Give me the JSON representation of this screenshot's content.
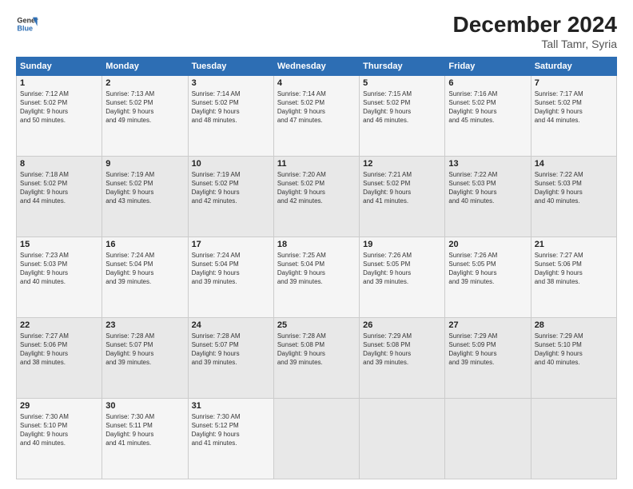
{
  "header": {
    "logo_line1": "General",
    "logo_line2": "Blue",
    "month": "December 2024",
    "location": "Tall Tamr, Syria"
  },
  "weekdays": [
    "Sunday",
    "Monday",
    "Tuesday",
    "Wednesday",
    "Thursday",
    "Friday",
    "Saturday"
  ],
  "weeks": [
    [
      {
        "day": "1",
        "info": "Sunrise: 7:12 AM\nSunset: 5:02 PM\nDaylight: 9 hours\nand 50 minutes."
      },
      {
        "day": "2",
        "info": "Sunrise: 7:13 AM\nSunset: 5:02 PM\nDaylight: 9 hours\nand 49 minutes."
      },
      {
        "day": "3",
        "info": "Sunrise: 7:14 AM\nSunset: 5:02 PM\nDaylight: 9 hours\nand 48 minutes."
      },
      {
        "day": "4",
        "info": "Sunrise: 7:14 AM\nSunset: 5:02 PM\nDaylight: 9 hours\nand 47 minutes."
      },
      {
        "day": "5",
        "info": "Sunrise: 7:15 AM\nSunset: 5:02 PM\nDaylight: 9 hours\nand 46 minutes."
      },
      {
        "day": "6",
        "info": "Sunrise: 7:16 AM\nSunset: 5:02 PM\nDaylight: 9 hours\nand 45 minutes."
      },
      {
        "day": "7",
        "info": "Sunrise: 7:17 AM\nSunset: 5:02 PM\nDaylight: 9 hours\nand 44 minutes."
      }
    ],
    [
      {
        "day": "8",
        "info": "Sunrise: 7:18 AM\nSunset: 5:02 PM\nDaylight: 9 hours\nand 44 minutes."
      },
      {
        "day": "9",
        "info": "Sunrise: 7:19 AM\nSunset: 5:02 PM\nDaylight: 9 hours\nand 43 minutes."
      },
      {
        "day": "10",
        "info": "Sunrise: 7:19 AM\nSunset: 5:02 PM\nDaylight: 9 hours\nand 42 minutes."
      },
      {
        "day": "11",
        "info": "Sunrise: 7:20 AM\nSunset: 5:02 PM\nDaylight: 9 hours\nand 42 minutes."
      },
      {
        "day": "12",
        "info": "Sunrise: 7:21 AM\nSunset: 5:02 PM\nDaylight: 9 hours\nand 41 minutes."
      },
      {
        "day": "13",
        "info": "Sunrise: 7:22 AM\nSunset: 5:03 PM\nDaylight: 9 hours\nand 40 minutes."
      },
      {
        "day": "14",
        "info": "Sunrise: 7:22 AM\nSunset: 5:03 PM\nDaylight: 9 hours\nand 40 minutes."
      }
    ],
    [
      {
        "day": "15",
        "info": "Sunrise: 7:23 AM\nSunset: 5:03 PM\nDaylight: 9 hours\nand 40 minutes."
      },
      {
        "day": "16",
        "info": "Sunrise: 7:24 AM\nSunset: 5:04 PM\nDaylight: 9 hours\nand 39 minutes."
      },
      {
        "day": "17",
        "info": "Sunrise: 7:24 AM\nSunset: 5:04 PM\nDaylight: 9 hours\nand 39 minutes."
      },
      {
        "day": "18",
        "info": "Sunrise: 7:25 AM\nSunset: 5:04 PM\nDaylight: 9 hours\nand 39 minutes."
      },
      {
        "day": "19",
        "info": "Sunrise: 7:26 AM\nSunset: 5:05 PM\nDaylight: 9 hours\nand 39 minutes."
      },
      {
        "day": "20",
        "info": "Sunrise: 7:26 AM\nSunset: 5:05 PM\nDaylight: 9 hours\nand 39 minutes."
      },
      {
        "day": "21",
        "info": "Sunrise: 7:27 AM\nSunset: 5:06 PM\nDaylight: 9 hours\nand 38 minutes."
      }
    ],
    [
      {
        "day": "22",
        "info": "Sunrise: 7:27 AM\nSunset: 5:06 PM\nDaylight: 9 hours\nand 38 minutes."
      },
      {
        "day": "23",
        "info": "Sunrise: 7:28 AM\nSunset: 5:07 PM\nDaylight: 9 hours\nand 39 minutes."
      },
      {
        "day": "24",
        "info": "Sunrise: 7:28 AM\nSunset: 5:07 PM\nDaylight: 9 hours\nand 39 minutes."
      },
      {
        "day": "25",
        "info": "Sunrise: 7:28 AM\nSunset: 5:08 PM\nDaylight: 9 hours\nand 39 minutes."
      },
      {
        "day": "26",
        "info": "Sunrise: 7:29 AM\nSunset: 5:08 PM\nDaylight: 9 hours\nand 39 minutes."
      },
      {
        "day": "27",
        "info": "Sunrise: 7:29 AM\nSunset: 5:09 PM\nDaylight: 9 hours\nand 39 minutes."
      },
      {
        "day": "28",
        "info": "Sunrise: 7:29 AM\nSunset: 5:10 PM\nDaylight: 9 hours\nand 40 minutes."
      }
    ],
    [
      {
        "day": "29",
        "info": "Sunrise: 7:30 AM\nSunset: 5:10 PM\nDaylight: 9 hours\nand 40 minutes."
      },
      {
        "day": "30",
        "info": "Sunrise: 7:30 AM\nSunset: 5:11 PM\nDaylight: 9 hours\nand 41 minutes."
      },
      {
        "day": "31",
        "info": "Sunrise: 7:30 AM\nSunset: 5:12 PM\nDaylight: 9 hours\nand 41 minutes."
      },
      null,
      null,
      null,
      null
    ]
  ]
}
